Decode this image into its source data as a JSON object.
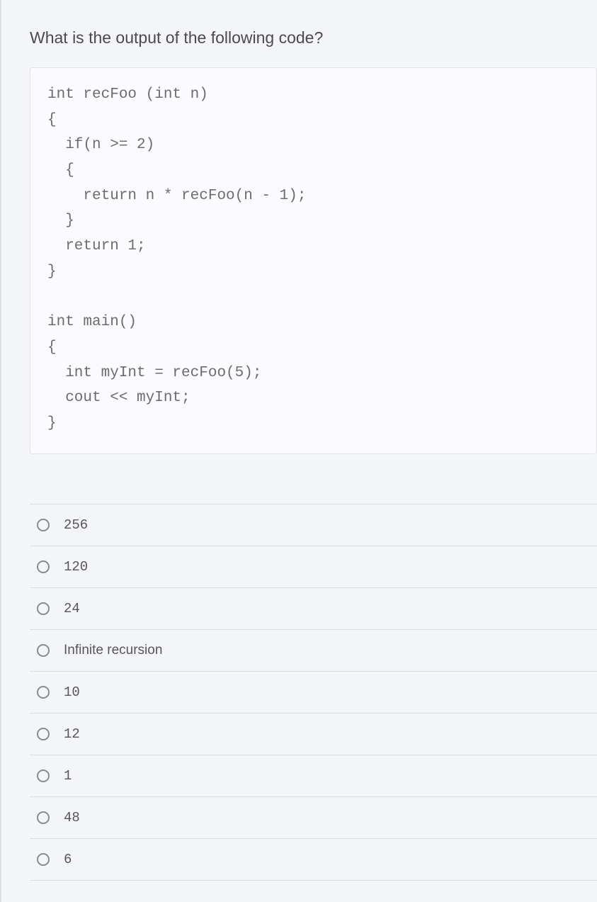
{
  "question": {
    "prompt": "What is the output of the following code?",
    "code": "int recFoo (int n)\n{\n  if(n >= 2)\n  {\n    return n * recFoo(n - 1);\n  }\n  return 1;\n}\n\nint main()\n{\n  int myInt = recFoo(5);\n  cout << myInt;\n}"
  },
  "options": [
    {
      "label": "256",
      "mono": true
    },
    {
      "label": "120",
      "mono": true
    },
    {
      "label": "24",
      "mono": true
    },
    {
      "label": "Infinite recursion",
      "mono": false
    },
    {
      "label": "10",
      "mono": true
    },
    {
      "label": "12",
      "mono": true
    },
    {
      "label": "1",
      "mono": true
    },
    {
      "label": "48",
      "mono": true
    },
    {
      "label": "6",
      "mono": true
    }
  ]
}
